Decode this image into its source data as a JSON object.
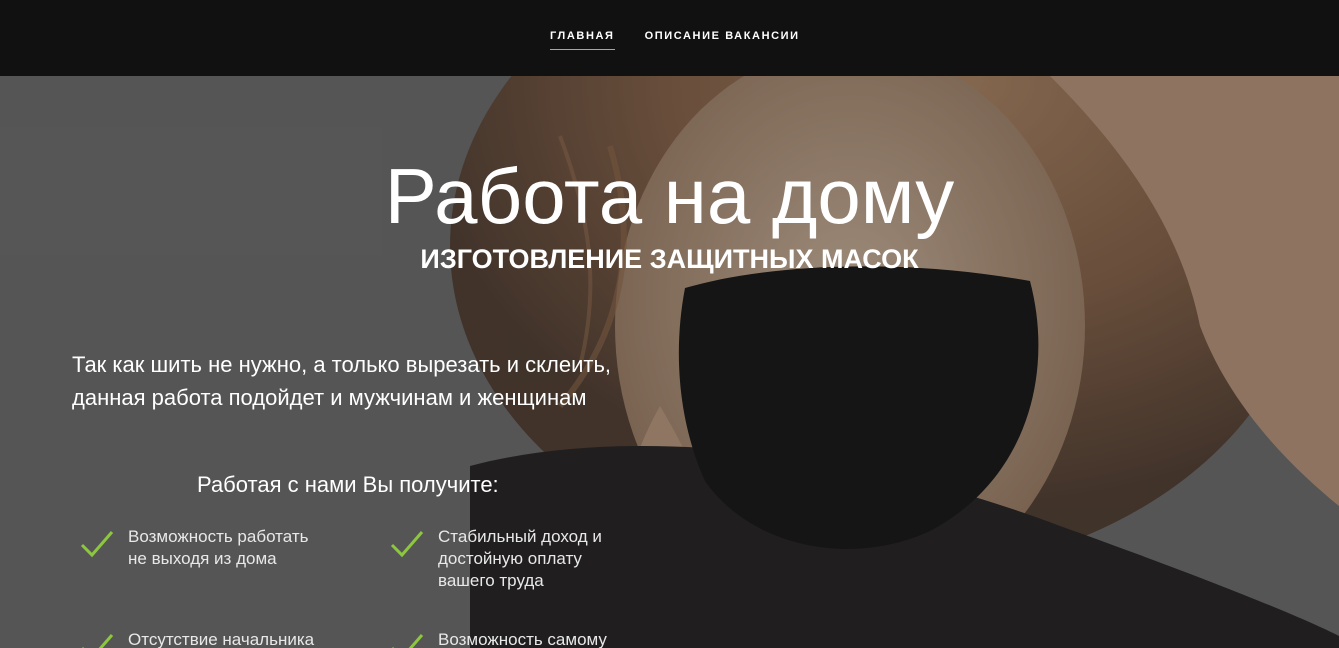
{
  "nav": {
    "items": [
      {
        "label": "ГЛАВНАЯ",
        "active": true
      },
      {
        "label": "ОПИСАНИЕ ВАКАНСИИ",
        "active": false
      }
    ]
  },
  "hero": {
    "title": "Работа на дому",
    "subtitle": "ИЗГОТОВЛЕНИЕ ЗАЩИТНЫХ МАСОК",
    "intro": "Так как шить не нужно, а только вырезать и склеить, данная работа подойдет и мужчинам и женщинам",
    "benefits_title": "Работая с нами Вы получите:",
    "benefits": [
      {
        "text": "Возможность работать не выходя из дома"
      },
      {
        "text": "Стабильный доход и достойную оплату вашего труда"
      },
      {
        "text": "Отсутствие начальника"
      },
      {
        "text": "Возможность самому"
      }
    ]
  },
  "colors": {
    "accent": "#8dc63f",
    "navbar": "#111111"
  },
  "icons": {
    "check": "check-icon"
  }
}
